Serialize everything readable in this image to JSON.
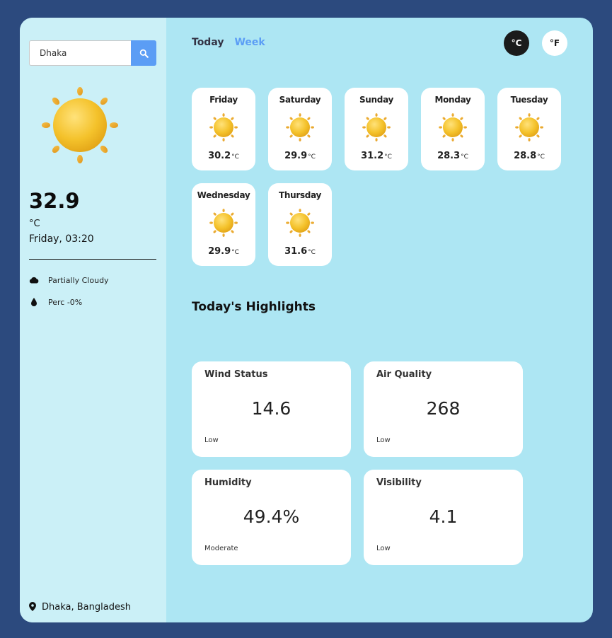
{
  "search": {
    "value": "Dhaka"
  },
  "current": {
    "temperature": "32.9",
    "unit": "°C",
    "date_time": "Friday, 03:20",
    "conditions": [
      {
        "label": "Partially Cloudy",
        "icon": "cloud-icon"
      },
      {
        "label": "Perc -0%",
        "icon": "droplet-icon"
      }
    ],
    "location": "Dhaka, Bangladesh"
  },
  "tabs": [
    {
      "label": "Today",
      "active": true
    },
    {
      "label": "Week",
      "active": false
    }
  ],
  "units": {
    "celsius": "°C",
    "fahrenheit": "°F",
    "selected": "celsius"
  },
  "forecast": [
    {
      "day": "Friday",
      "temp": "30.2",
      "unit": "°C",
      "icon": "sun-icon"
    },
    {
      "day": "Saturday",
      "temp": "29.9",
      "unit": "°C",
      "icon": "sun-icon"
    },
    {
      "day": "Sunday",
      "temp": "31.2",
      "unit": "°C",
      "icon": "sun-icon"
    },
    {
      "day": "Monday",
      "temp": "28.3",
      "unit": "°C",
      "icon": "sun-icon"
    },
    {
      "day": "Tuesday",
      "temp": "28.8",
      "unit": "°C",
      "icon": "sun-icon"
    },
    {
      "day": "Wednesday",
      "temp": "29.9",
      "unit": "°C",
      "icon": "sun-icon"
    },
    {
      "day": "Thursday",
      "temp": "31.6",
      "unit": "°C",
      "icon": "sun-icon"
    }
  ],
  "highlights": {
    "title": "Today's Highlights",
    "cards": [
      {
        "title": "Wind Status",
        "value": "14.6",
        "status": "Low"
      },
      {
        "title": "Air Quality",
        "value": "268",
        "status": "Low"
      },
      {
        "title": "Humidity",
        "value": "49.4%",
        "status": "Moderate"
      },
      {
        "title": "Visibility",
        "value": "4.1",
        "status": "Low"
      }
    ]
  },
  "colors": {
    "page_bg": "#2c4a7e",
    "sidebar_bg": "#cbf0f7",
    "main_bg": "#ade6f3",
    "accent": "#5b9df5"
  }
}
